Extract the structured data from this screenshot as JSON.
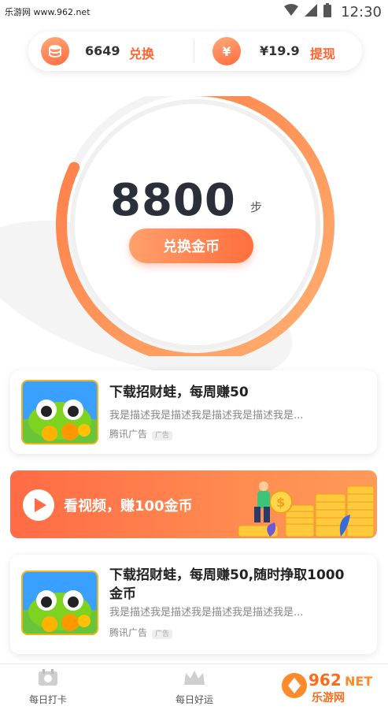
{
  "status_bar": {
    "watermark": "乐游网 www.962.net",
    "time": "12:30"
  },
  "coin_bar": {
    "coins": "6649",
    "coins_action": "兑换",
    "cash": "¥19.9",
    "cash_action": "提现",
    "cash_icon_glyph": "¥"
  },
  "steps": {
    "value": "8800",
    "unit": "步",
    "button": "兑换金币",
    "ring_progress": 0.82
  },
  "ads": [
    {
      "title": "下载招财蛙，每周赚50",
      "desc": "我是描述我是描述我是描述我是描述我是...",
      "source": "腾讯广告",
      "tag": "广告"
    },
    {
      "title": "下载招财蛙，每周赚50,随时挣取1000金币",
      "desc": "我是描述我是描述我是描述我是描述我是...",
      "source": "腾讯广告",
      "tag": "广告"
    }
  ],
  "banner": {
    "text": "看视频，赚100金币"
  },
  "nav": {
    "items": [
      {
        "label": "每日打卡",
        "icon": "calendar-check-icon"
      },
      {
        "label": "每日好运",
        "icon": "crown-icon"
      }
    ]
  },
  "watermark_bottom": "962.NET 乐游网",
  "colors": {
    "accent": "#ff6b3d",
    "accent_light": "#ffa06c",
    "ring_track": "#eeeeee"
  }
}
